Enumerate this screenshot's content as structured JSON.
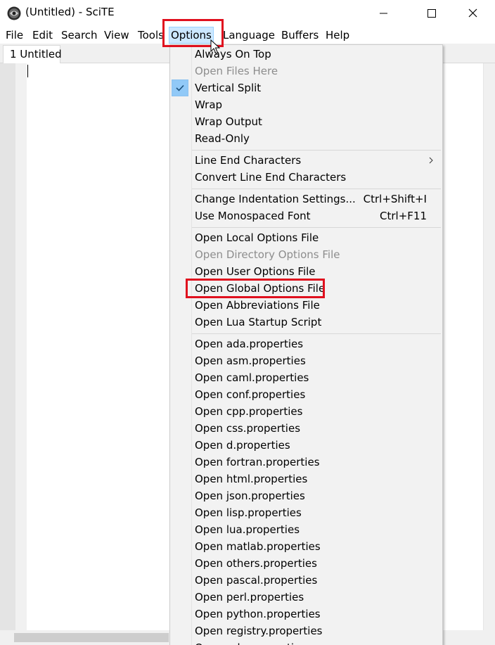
{
  "window": {
    "title": "(Untitled) - SciTE"
  },
  "menubar": {
    "items": [
      {
        "label": "File"
      },
      {
        "label": "Edit"
      },
      {
        "label": "Search"
      },
      {
        "label": "View"
      },
      {
        "label": "Tools"
      },
      {
        "label": "Options"
      },
      {
        "label": "Language"
      },
      {
        "label": "Buffers"
      },
      {
        "label": "Help"
      }
    ]
  },
  "tabs": [
    {
      "label": "1 Untitled"
    }
  ],
  "options_menu": {
    "group1": [
      {
        "label": "Always On Top",
        "enabled": true
      },
      {
        "label": "Open Files Here",
        "enabled": false
      },
      {
        "label": "Vertical Split",
        "enabled": true,
        "checked": true
      },
      {
        "label": "Wrap",
        "enabled": true
      },
      {
        "label": "Wrap Output",
        "enabled": true
      },
      {
        "label": "Read-Only",
        "enabled": true
      }
    ],
    "group2": [
      {
        "label": "Line End Characters",
        "submenu": true
      },
      {
        "label": "Convert Line End Characters"
      }
    ],
    "group3": [
      {
        "label": "Change Indentation Settings...",
        "shortcut": "Ctrl+Shift+I"
      },
      {
        "label": "Use Monospaced Font",
        "shortcut": "Ctrl+F11"
      }
    ],
    "group4": [
      {
        "label": "Open Local Options File",
        "enabled": true
      },
      {
        "label": "Open Directory Options File",
        "enabled": false
      },
      {
        "label": "Open User Options File",
        "enabled": true
      },
      {
        "label": "Open Global Options File",
        "enabled": true,
        "highlighted_annotation": true
      },
      {
        "label": "Open Abbreviations File",
        "enabled": true
      },
      {
        "label": "Open Lua Startup Script",
        "enabled": true
      }
    ],
    "group5": [
      {
        "label": "Open ada.properties"
      },
      {
        "label": "Open asm.properties"
      },
      {
        "label": "Open caml.properties"
      },
      {
        "label": "Open conf.properties"
      },
      {
        "label": "Open cpp.properties"
      },
      {
        "label": "Open css.properties"
      },
      {
        "label": "Open d.properties"
      },
      {
        "label": "Open fortran.properties"
      },
      {
        "label": "Open html.properties"
      },
      {
        "label": "Open json.properties"
      },
      {
        "label": "Open lisp.properties"
      },
      {
        "label": "Open lua.properties"
      },
      {
        "label": "Open matlab.properties"
      },
      {
        "label": "Open others.properties"
      },
      {
        "label": "Open pascal.properties"
      },
      {
        "label": "Open perl.properties"
      },
      {
        "label": "Open python.properties"
      },
      {
        "label": "Open registry.properties"
      },
      {
        "label": "Open ruby.properties"
      }
    ]
  },
  "colors": {
    "annotation_red": "#e0101e",
    "menu_hover": "#cce8ff",
    "check_bg": "#91c9f7",
    "disabled_text": "#8d8d8d"
  },
  "icons": [
    "scite-app-icon",
    "minimize-icon",
    "maximize-icon",
    "close-icon",
    "checkmark-icon",
    "submenu-arrow-icon",
    "mouse-cursor-icon"
  ]
}
